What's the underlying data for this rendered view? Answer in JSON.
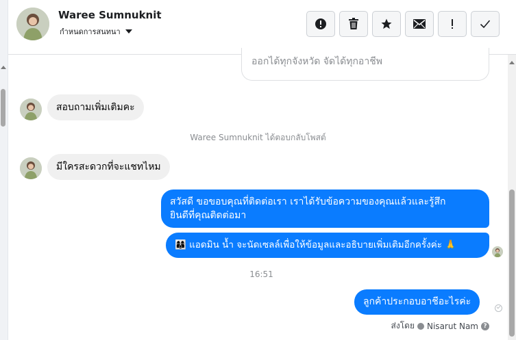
{
  "header": {
    "name": "Waree Sumnuknit",
    "subtitle": "กำหนดการสนทนา",
    "actions": [
      "warning-icon",
      "trash-icon",
      "star-icon",
      "envelope-icon",
      "exclamation-icon",
      "check-icon"
    ]
  },
  "quoted_text": "ออกได้ทุกจังหวัด จัดได้ทุกอาชีพ",
  "messages": {
    "in1": "สอบถามเพิ่มเติมคะ",
    "system": "Waree Sumnuknit ได้ตอบกลับโพสต์",
    "in2": "มีใครสะดวกที่จะแชทไหม",
    "out1_line1": "สวัสดี ขอขอบคุณที่ติดต่อเรา เราได้รับข้อความของคุณแล้วและรู้สึก",
    "out1_line2": "ยินดีที่คุณติดต่อมา",
    "out2": "👩‍👩‍👦 แอดมิน น้ำ จะนัดเซลล์เพื่อให้ข้อมูลและอธิบายเพิ่มเติมอีกครั้งค่ะ 🙏",
    "timestamp": "16:51",
    "out3": "ลูกค้าประกอบอาชีอะไรค่ะ",
    "sent_by_label": "ส่งโดย",
    "sent_by_name": "Nisarut Nam"
  },
  "colors": {
    "outgoing_bubble": "#0a7cff",
    "incoming_bubble": "#f0f0f0"
  }
}
